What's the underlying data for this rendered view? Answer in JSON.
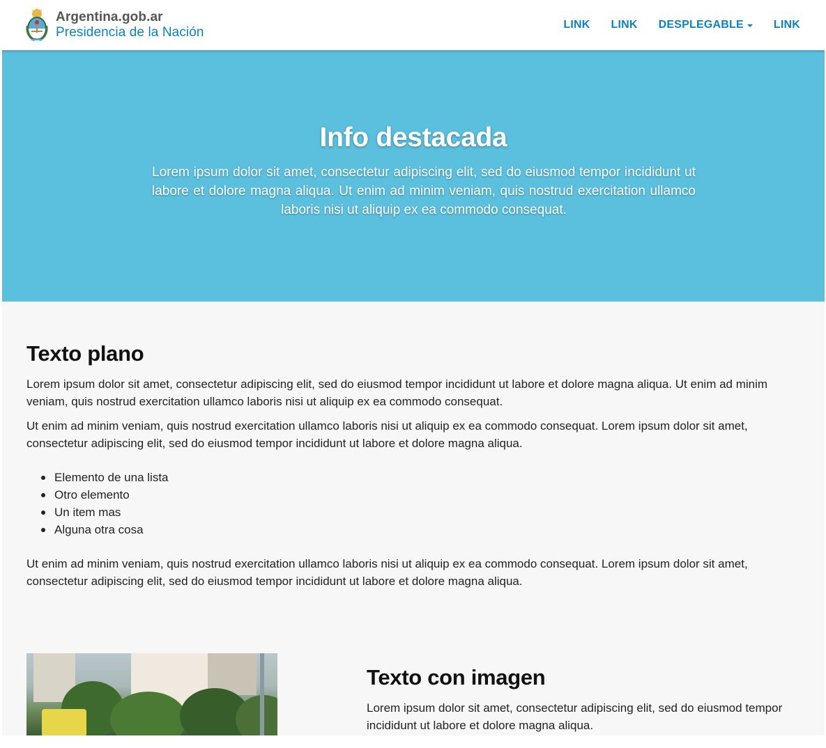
{
  "brand": {
    "line1": "Argentina.gob.ar",
    "line2": "Presidencia de la Nación"
  },
  "nav": {
    "items": [
      {
        "label": "LINK"
      },
      {
        "label": "LINK"
      },
      {
        "label": "DESPLEGABLE"
      },
      {
        "label": "LINK"
      }
    ]
  },
  "hero": {
    "title": "Info destacada",
    "text": "Lorem ipsum dolor sit amet, consectetur adipiscing elit, sed do eiusmod tempor incididunt ut labore et dolore magna aliqua. Ut enim ad minim veniam, quis nostrud exercitation ullamco laboris nisi ut aliquip ex ea commodo consequat."
  },
  "plain": {
    "title": "Texto plano",
    "p1": "Lorem ipsum dolor sit amet, consectetur adipiscing elit, sed do eiusmod tempor incididunt ut labore et dolore magna aliqua. Ut enim ad minim veniam, quis nostrud exercitation ullamco laboris nisi ut aliquip ex ea commodo consequat.",
    "p2": "Ut enim ad minim veniam, quis nostrud exercitation ullamco laboris nisi ut aliquip ex ea commodo consequat. Lorem ipsum dolor sit amet, consectetur adipiscing elit, sed do eiusmod tempor incididunt ut labore et dolore magna aliqua.",
    "list": [
      "Elemento de una lista",
      "Otro elemento",
      "Un item mas",
      "Alguna otra cosa"
    ],
    "p3": "Ut enim ad minim veniam, quis nostrud exercitation ullamco laboris nisi ut aliquip ex ea commodo consequat. Lorem ipsum dolor sit amet, consectetur adipiscing elit, sed do eiusmod tempor incididunt ut labore et dolore magna aliqua."
  },
  "image_section": {
    "title": "Texto con imagen",
    "p1": "Lorem ipsum dolor sit amet, consectetur adipiscing elit, sed do eiusmod tempor incididunt ut labore et dolore magna aliqua."
  },
  "colors": {
    "brand_blue": "#0a82c4",
    "hero_bg": "#5bbfde",
    "page_bg": "#f7f7f7"
  }
}
